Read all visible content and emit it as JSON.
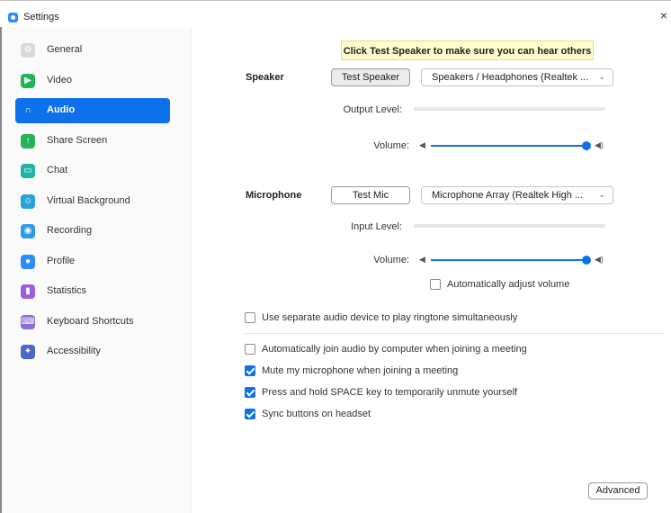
{
  "window": {
    "title": "Settings",
    "close_glyph": "×"
  },
  "sidebar": {
    "items": [
      {
        "label": "General",
        "icon": "gear-icon",
        "color": "#d9d9d9",
        "glyph": "⚙",
        "active": false
      },
      {
        "label": "Video",
        "icon": "video-icon",
        "color": "#23b45b",
        "glyph": "▶",
        "active": false
      },
      {
        "label": "Audio",
        "icon": "headphones-icon",
        "color": "#0e71eb",
        "glyph": "∩",
        "active": true
      },
      {
        "label": "Share Screen",
        "icon": "share-screen-icon",
        "color": "#23b45b",
        "glyph": "↑",
        "active": false
      },
      {
        "label": "Chat",
        "icon": "chat-icon",
        "color": "#1fb5a5",
        "glyph": "▭",
        "active": false
      },
      {
        "label": "Virtual Background",
        "icon": "person-icon",
        "color": "#25a2d9",
        "glyph": "☺",
        "active": false
      },
      {
        "label": "Recording",
        "icon": "recording-icon",
        "color": "#2d9ce8",
        "glyph": "◉",
        "active": false
      },
      {
        "label": "Profile",
        "icon": "profile-icon",
        "color": "#2d8cff",
        "glyph": "●",
        "active": false
      },
      {
        "label": "Statistics",
        "icon": "statistics-icon",
        "color": "#9b5fd6",
        "glyph": "▮",
        "active": false
      },
      {
        "label": "Keyboard Shortcuts",
        "icon": "keyboard-icon",
        "color": "#8c6cd6",
        "glyph": "⌨",
        "active": false
      },
      {
        "label": "Accessibility",
        "icon": "accessibility-icon",
        "color": "#4a67c9",
        "glyph": "✦",
        "active": false
      }
    ]
  },
  "tooltip": {
    "text": "Click Test Speaker to make sure you can hear others"
  },
  "speaker": {
    "label": "Speaker",
    "test_button": "Test Speaker",
    "device": "Speakers / Headphones (Realtek ...",
    "output_level_label": "Output Level:",
    "volume_label": "Volume:",
    "volume_percent": 100
  },
  "microphone": {
    "label": "Microphone",
    "test_button": "Test Mic",
    "device": "Microphone Array (Realtek High ...",
    "input_level_label": "Input Level:",
    "volume_label": "Volume:",
    "volume_percent": 100,
    "auto_adjust_label": "Automatically adjust volume",
    "auto_adjust_checked": false
  },
  "options": {
    "separate_device": {
      "label": "Use separate audio device to play ringtone simultaneously",
      "checked": false
    },
    "auto_join": {
      "label": "Automatically join audio by computer when joining a meeting",
      "checked": false
    },
    "mute_on_join": {
      "label": "Mute my microphone when joining a meeting",
      "checked": true
    },
    "space_unmute": {
      "label": "Press and hold SPACE key to temporarily unmute yourself",
      "checked": true
    },
    "sync_headset": {
      "label": "Sync buttons on headset",
      "checked": true
    }
  },
  "advanced_button": "Advanced",
  "colors": {
    "accent": "#0e71eb"
  }
}
